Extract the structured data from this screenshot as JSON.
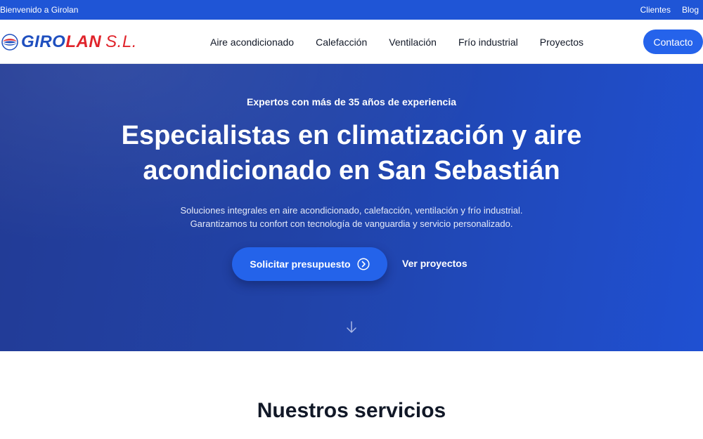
{
  "topbar": {
    "welcome": "Bienvenido a Girolan",
    "links": [
      {
        "label": "Clientes"
      },
      {
        "label": "Blog"
      }
    ]
  },
  "header": {
    "logo": {
      "part1": "GIRO",
      "part2": "LAN",
      "suffix": "S.L."
    },
    "nav": [
      {
        "label": "Aire acondicionado"
      },
      {
        "label": "Calefacción"
      },
      {
        "label": "Ventilación"
      },
      {
        "label": "Frío industrial"
      },
      {
        "label": "Proyectos"
      }
    ],
    "contact_label": "Contacto"
  },
  "hero": {
    "eyebrow": "Expertos con más de 35 años de experiencia",
    "title": "Especialistas en climatización y aire acondicionado en San Sebastián",
    "subtitle_line1": "Soluciones integrales en aire acondicionado, calefacción, ventilación y frío industrial.",
    "subtitle_line2": "Garantizamos tu confort con tecnología de vanguardia y servicio personalizado.",
    "primary_cta": "Solicitar presupuesto",
    "secondary_cta": "Ver proyectos"
  },
  "services": {
    "title": "Nuestros servicios"
  },
  "icons": {
    "logo_mark": "logo-globe-icon",
    "cta_arrow": "chevron-right-circle-icon",
    "scroll": "arrow-down-icon"
  },
  "colors": {
    "brand_blue": "#2563eb",
    "topbar_blue": "#1f55d6",
    "logo_red": "#e0242b",
    "hero_dark": "#223b95"
  }
}
